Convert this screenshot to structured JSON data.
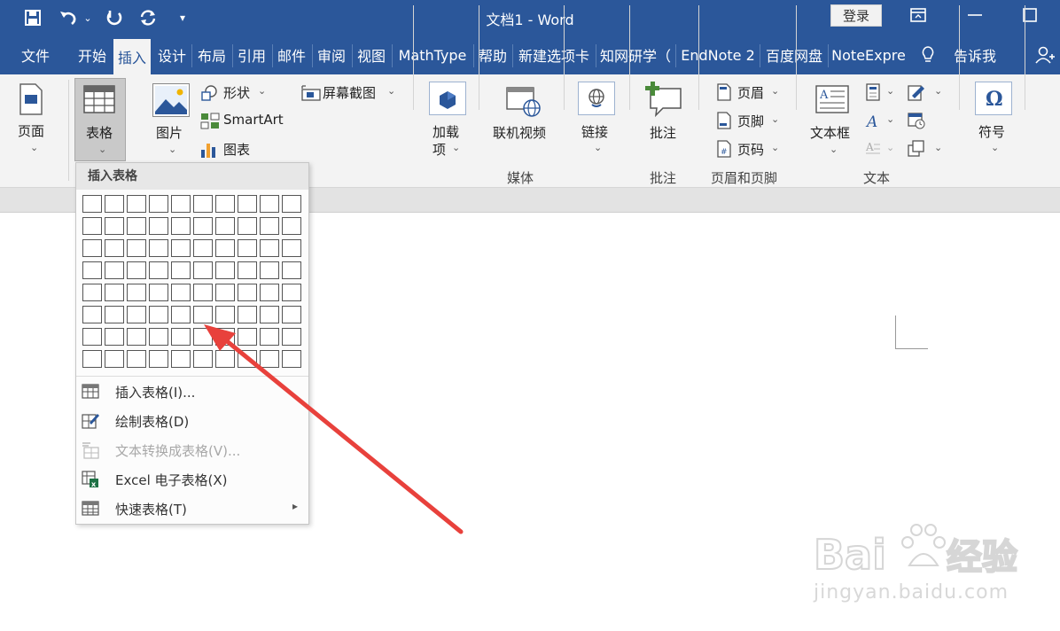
{
  "window": {
    "title": "文档1  -  Word",
    "login_label": "登录"
  },
  "tabs": [
    {
      "label": "文件"
    },
    {
      "label": "开始"
    },
    {
      "label": "插入",
      "active": true
    },
    {
      "label": "设计"
    },
    {
      "label": "布局"
    },
    {
      "label": "引用"
    },
    {
      "label": "邮件"
    },
    {
      "label": "审阅"
    },
    {
      "label": "视图"
    },
    {
      "label": "MathType"
    },
    {
      "label": "帮助"
    },
    {
      "label": "新建选项卡"
    },
    {
      "label": "知网研学（"
    },
    {
      "label": "EndNote 2"
    },
    {
      "label": "百度网盘"
    },
    {
      "label": "NoteExpre"
    },
    {
      "label": "告诉我"
    }
  ],
  "ribbon": {
    "pages_label": "页面",
    "table_label": "表格",
    "picture_label": "图片",
    "shapes_label": "形状",
    "smartart_label": "SmartArt",
    "chart_label": "图表",
    "screenshot_label": "屏幕截图",
    "addins_label_1": "加载",
    "addins_label_2": "项",
    "online_video_label": "联机视频",
    "media_group": "媒体",
    "link_label": "链接",
    "comment_label": "批注",
    "comment_group": "批注",
    "header_label": "页眉",
    "footer_label": "页脚",
    "pagenum_label": "页码",
    "header_footer_group": "页眉和页脚",
    "textbox_label": "文本框",
    "text_group": "文本",
    "symbol_label": "符号"
  },
  "dropdown": {
    "header": "插入表格",
    "grid_cols": 10,
    "grid_rows": 8,
    "items": [
      {
        "label": "插入表格(I)...",
        "icon": "table-icon",
        "enabled": true
      },
      {
        "label": "绘制表格(D)",
        "icon": "draw-table-icon",
        "enabled": true
      },
      {
        "label": "文本转换成表格(V)...",
        "icon": "convert-text-icon",
        "enabled": false
      },
      {
        "label": "Excel 电子表格(X)",
        "icon": "excel-icon",
        "enabled": true
      },
      {
        "label": "快速表格(T)",
        "icon": "quick-table-icon",
        "enabled": true,
        "submenu": true
      }
    ]
  },
  "watermark": {
    "text": "jingyan.baidu.com"
  },
  "colors": {
    "title_bar": "#2b579a",
    "ribbon": "#f3f3f3",
    "arrow": "#e8413c"
  }
}
